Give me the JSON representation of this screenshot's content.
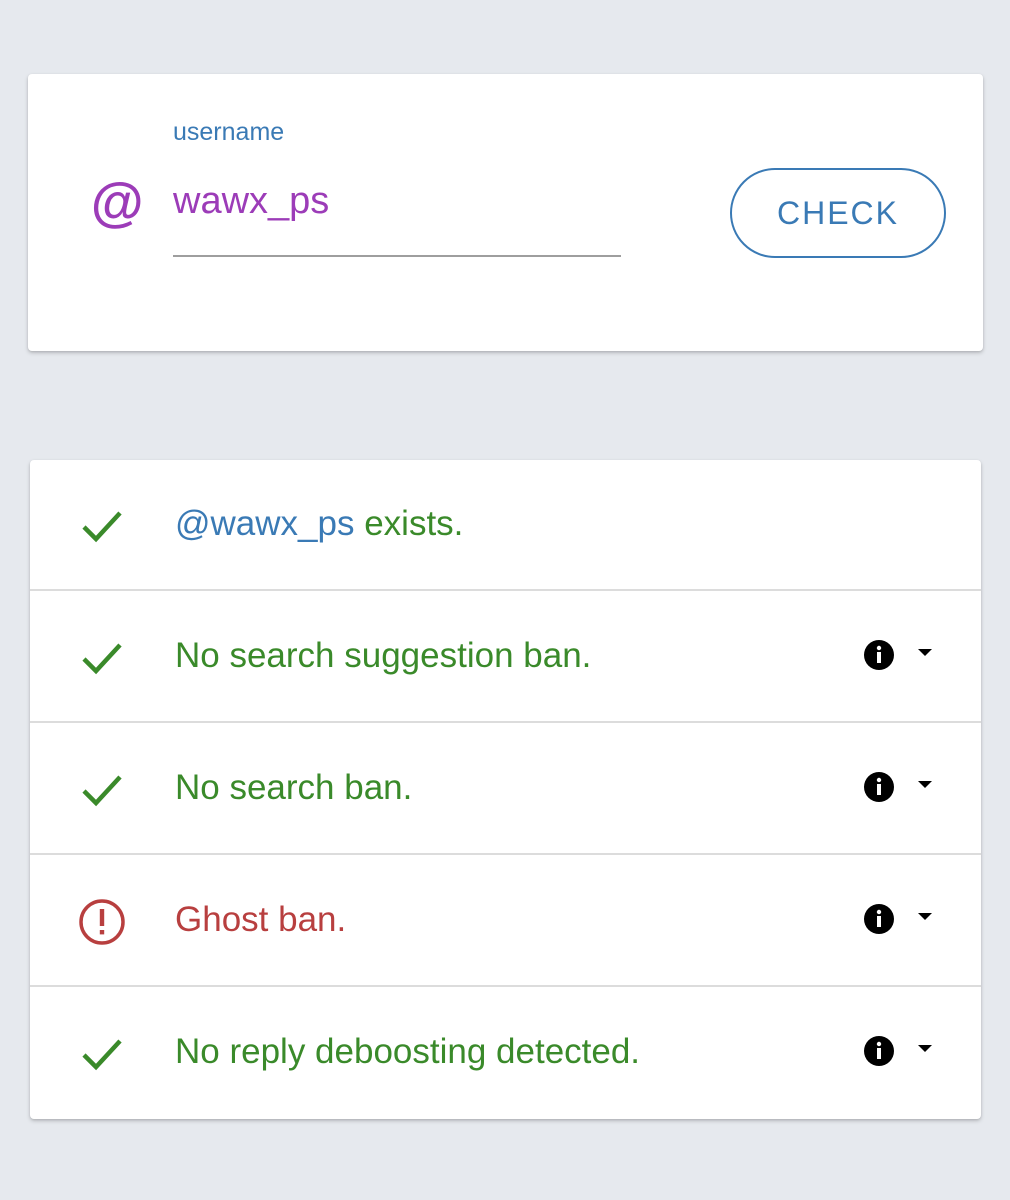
{
  "search": {
    "label": "username",
    "value": "wawx_ps",
    "prefix_icon": "at-sign-icon",
    "check_label": "CHECK"
  },
  "results": [
    {
      "status": "ok",
      "handle": "@wawx_ps",
      "text": " exists.",
      "has_info": false
    },
    {
      "status": "ok",
      "text": "No search suggestion ban.",
      "has_info": true
    },
    {
      "status": "ok",
      "text": "No search ban.",
      "has_info": true
    },
    {
      "status": "bad",
      "text": "Ghost ban.",
      "has_info": true
    },
    {
      "status": "ok",
      "text": "No reply deboosting detected.",
      "has_info": true
    }
  ],
  "colors": {
    "background": "#e6e9ee",
    "accent": "#3a7ab5",
    "username": "#9c3cb8",
    "ok": "#3a8a2a",
    "bad": "#b83f3f"
  }
}
